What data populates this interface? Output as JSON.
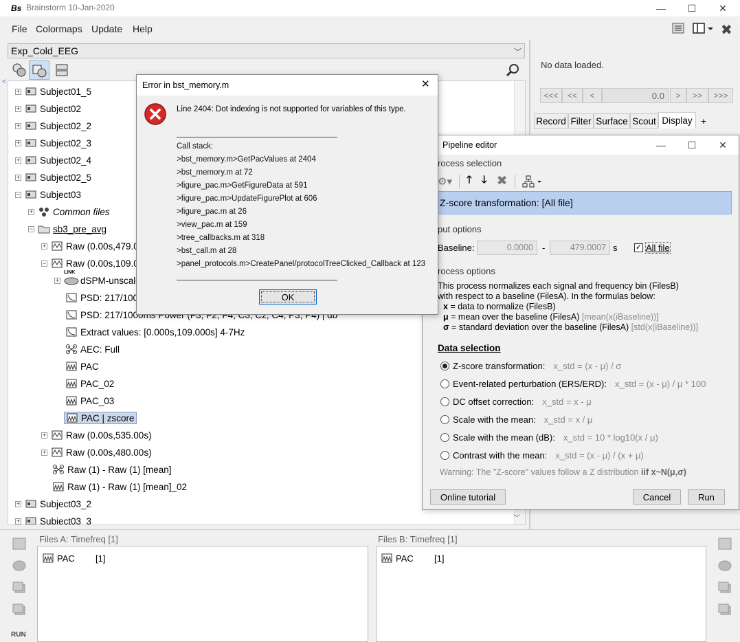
{
  "window": {
    "title": "Brainstorm 10-Jan-2020",
    "app_icon": "Bs"
  },
  "menu": [
    "File",
    "Colormaps",
    "Update",
    "Help"
  ],
  "protocol": "Exp_Cold_EEG",
  "tree": {
    "subjects_top": [
      "Subject01_5",
      "Subject02",
      "Subject02_2",
      "Subject02_3",
      "Subject02_4",
      "Subject02_5",
      "Subject03"
    ],
    "common_files": "Common files",
    "condition": "sb3_pre_avg",
    "raw1": "Raw (0.00s,479.0",
    "raw2": "Raw (0.00s,109.0",
    "dspm": "dSPM-unscale",
    "link_badge": "LINK",
    "psd1": "PSD: 217/100",
    "psd2": "PSD: 217/1000ms Power (F3, F2, F4, C3, Cz, C4, P3, P4) | db",
    "extract": "Extract values: [0.000s,109.000s] 4-7Hz",
    "aec": "AEC: Full",
    "pac1": "PAC",
    "pac2": "PAC_02",
    "pac3": "PAC_03",
    "pac_z": "PAC | zscore",
    "raw3": "Raw (0.00s,535.00s)",
    "raw4": "Raw (0.00s,480.00s)",
    "mean1": "Raw (1) - Raw (1) [mean]",
    "mean2": "Raw (1) - Raw (1) [mean]_02",
    "subjects_bottom": [
      "Subject03_2",
      "Subject03_3"
    ]
  },
  "right_panel": {
    "status": "No data loaded.",
    "nav": [
      "<<<",
      "<<",
      "<",
      ">",
      ">>",
      ">>>"
    ],
    "time_value": "0.0",
    "tabs": [
      "Record",
      "Filter",
      "Surface",
      "Scout",
      "Display",
      "+"
    ],
    "active_tab": "Display"
  },
  "files_a": {
    "title": "Files A: Timefreq [1]",
    "item": "PAC",
    "count": "[1]"
  },
  "files_b": {
    "title": "Files B: Timefreq [1]",
    "item": "PAC",
    "count": "[1]"
  },
  "run_label": "RUN",
  "error_dialog": {
    "title": "Error in bst_memory.m",
    "message": "Line 2404: Dot indexing is not supported for variables of this type.",
    "call_stack_label": "Call stack:",
    "stack": [
      ">bst_memory.m>GetPacValues at 2404",
      ">bst_memory.m at 72",
      ">figure_pac.m>GetFigureData at 591",
      ">figure_pac.m>UpdateFigurePlot at 606",
      ">figure_pac.m at 26",
      ">view_pac.m at 159",
      ">tree_callbacks.m at 318",
      ">bst_call.m at 28",
      ">panel_protocols.m>CreatePanel/protocolTreeClicked_Callback at 123"
    ],
    "ok": "OK"
  },
  "pipeline": {
    "title": "Pipeline editor",
    "process_selection": "rocess selection",
    "process_name": "Z-score transformation: [All file]",
    "input_options": "put options",
    "baseline_label": "Baseline:",
    "baseline_start": "0.0000",
    "baseline_sep": "-",
    "baseline_end": "479.0007",
    "baseline_unit": "s",
    "all_file": "All file",
    "process_options": "rocess options",
    "desc1": "This process normalizes each signal and frequency bin (FilesB)",
    "desc2": "with respect to a baseline (FilesA). In the formulas below:",
    "x_sym": "x",
    "x_def": "= data to normalize (FilesB)",
    "mu_sym": "μ",
    "mu_def": "= mean over the baseline (FilesA)",
    "mu_formula": "[mean(x(iBaseline))]",
    "sigma_sym": "σ",
    "sigma_def": "= standard deviation over the baseline (FilesA)",
    "sigma_formula": "[std(x(iBaseline))]",
    "data_selection": "Data selection",
    "options": [
      {
        "label": "Z-score transformation:",
        "formula": "x_std = (x - μ) / σ",
        "selected": true
      },
      {
        "label": "Event-related perturbation (ERS/ERD):",
        "formula": "x_std = (x - μ) / μ * 100",
        "selected": false
      },
      {
        "label": "DC offset correction:",
        "formula": "x_std = x - μ",
        "selected": false
      },
      {
        "label": "Scale with the mean:",
        "formula": "x_std = x / μ",
        "selected": false
      },
      {
        "label": "Scale with the mean (dB):",
        "formula": "x_std = 10 * log10(x / μ)",
        "selected": false
      },
      {
        "label": "Contrast with the mean:",
        "formula": "x_std = (x - μ) / (x + μ)",
        "selected": false
      }
    ],
    "warning": "Warning: The \"Z-score\" values follow a Z distribution",
    "warning_bold": "iif x~N(μ,σ)",
    "online_tutorial": "Online tutorial",
    "cancel": "Cancel",
    "run": "Run"
  },
  "colors": {
    "selection": "#cbd7ea",
    "process_highlight": "#b9cff0",
    "error_red": "#d52a2a"
  }
}
